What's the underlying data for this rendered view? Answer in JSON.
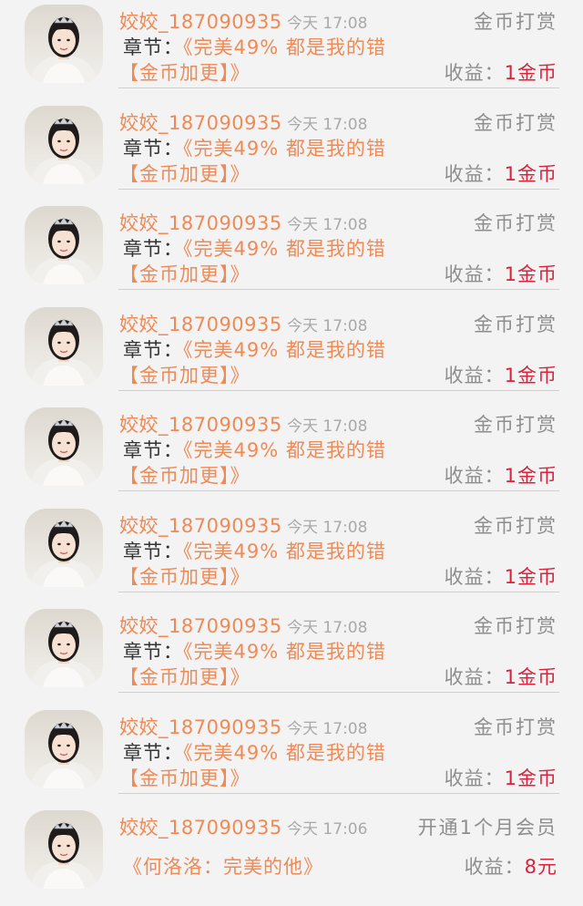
{
  "records": [
    {
      "user": "姣姣_187090935",
      "time": "今天 17:08",
      "type": "金币打赏",
      "chapter_label": "章节：",
      "chapter_title": "《完美49% 都是我的错",
      "chapter_title_cont": "【金币加更】》",
      "earn_label": "收益：",
      "earn_amount": "1金币"
    },
    {
      "user": "姣姣_187090935",
      "time": "今天 17:08",
      "type": "金币打赏",
      "chapter_label": "章节：",
      "chapter_title": "《完美49% 都是我的错",
      "chapter_title_cont": "【金币加更】》",
      "earn_label": "收益：",
      "earn_amount": "1金币"
    },
    {
      "user": "姣姣_187090935",
      "time": "今天 17:08",
      "type": "金币打赏",
      "chapter_label": "章节：",
      "chapter_title": "《完美49% 都是我的错",
      "chapter_title_cont": "【金币加更】》",
      "earn_label": "收益：",
      "earn_amount": "1金币"
    },
    {
      "user": "姣姣_187090935",
      "time": "今天 17:08",
      "type": "金币打赏",
      "chapter_label": "章节：",
      "chapter_title": "《完美49% 都是我的错",
      "chapter_title_cont": "【金币加更】》",
      "earn_label": "收益：",
      "earn_amount": "1金币"
    },
    {
      "user": "姣姣_187090935",
      "time": "今天 17:08",
      "type": "金币打赏",
      "chapter_label": "章节：",
      "chapter_title": "《完美49% 都是我的错",
      "chapter_title_cont": "【金币加更】》",
      "earn_label": "收益：",
      "earn_amount": "1金币"
    },
    {
      "user": "姣姣_187090935",
      "time": "今天 17:08",
      "type": "金币打赏",
      "chapter_label": "章节：",
      "chapter_title": "《完美49% 都是我的错",
      "chapter_title_cont": "【金币加更】》",
      "earn_label": "收益：",
      "earn_amount": "1金币"
    },
    {
      "user": "姣姣_187090935",
      "time": "今天 17:08",
      "type": "金币打赏",
      "chapter_label": "章节：",
      "chapter_title": "《完美49% 都是我的错",
      "chapter_title_cont": "【金币加更】》",
      "earn_label": "收益：",
      "earn_amount": "1金币"
    },
    {
      "user": "姣姣_187090935",
      "time": "今天 17:08",
      "type": "金币打赏",
      "chapter_label": "章节：",
      "chapter_title": "《完美49% 都是我的错",
      "chapter_title_cont": "【金币加更】》",
      "earn_label": "收益：",
      "earn_amount": "1金币"
    },
    {
      "user": "姣姣_187090935",
      "time": "今天 17:06",
      "type": "开通1个月会员",
      "chapter_label": "",
      "chapter_title": "《何洛洛：完美的他》",
      "chapter_title_cont": "",
      "earn_label": "收益：",
      "earn_amount": "8元"
    }
  ],
  "colors": {
    "accent_orange": "#ee8a55",
    "earn_red": "#d6243c",
    "muted_gray": "#8e8e8e",
    "divider": "#cfcfcf",
    "background": "#f4f3f4"
  },
  "icons": {
    "avatar": "user-avatar-photo"
  }
}
